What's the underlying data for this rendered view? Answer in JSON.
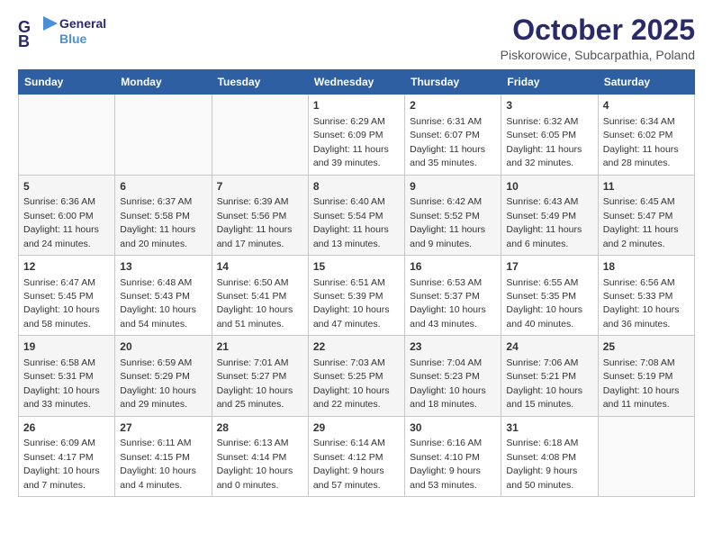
{
  "logo": {
    "line1": "General",
    "line2": "Blue"
  },
  "title": "October 2025",
  "subtitle": "Piskorowice, Subcarpathia, Poland",
  "headers": [
    "Sunday",
    "Monday",
    "Tuesday",
    "Wednesday",
    "Thursday",
    "Friday",
    "Saturday"
  ],
  "weeks": [
    [
      {
        "day": "",
        "info": ""
      },
      {
        "day": "",
        "info": ""
      },
      {
        "day": "",
        "info": ""
      },
      {
        "day": "1",
        "info": "Sunrise: 6:29 AM\nSunset: 6:09 PM\nDaylight: 11 hours\nand 39 minutes."
      },
      {
        "day": "2",
        "info": "Sunrise: 6:31 AM\nSunset: 6:07 PM\nDaylight: 11 hours\nand 35 minutes."
      },
      {
        "day": "3",
        "info": "Sunrise: 6:32 AM\nSunset: 6:05 PM\nDaylight: 11 hours\nand 32 minutes."
      },
      {
        "day": "4",
        "info": "Sunrise: 6:34 AM\nSunset: 6:02 PM\nDaylight: 11 hours\nand 28 minutes."
      }
    ],
    [
      {
        "day": "5",
        "info": "Sunrise: 6:36 AM\nSunset: 6:00 PM\nDaylight: 11 hours\nand 24 minutes."
      },
      {
        "day": "6",
        "info": "Sunrise: 6:37 AM\nSunset: 5:58 PM\nDaylight: 11 hours\nand 20 minutes."
      },
      {
        "day": "7",
        "info": "Sunrise: 6:39 AM\nSunset: 5:56 PM\nDaylight: 11 hours\nand 17 minutes."
      },
      {
        "day": "8",
        "info": "Sunrise: 6:40 AM\nSunset: 5:54 PM\nDaylight: 11 hours\nand 13 minutes."
      },
      {
        "day": "9",
        "info": "Sunrise: 6:42 AM\nSunset: 5:52 PM\nDaylight: 11 hours\nand 9 minutes."
      },
      {
        "day": "10",
        "info": "Sunrise: 6:43 AM\nSunset: 5:49 PM\nDaylight: 11 hours\nand 6 minutes."
      },
      {
        "day": "11",
        "info": "Sunrise: 6:45 AM\nSunset: 5:47 PM\nDaylight: 11 hours\nand 2 minutes."
      }
    ],
    [
      {
        "day": "12",
        "info": "Sunrise: 6:47 AM\nSunset: 5:45 PM\nDaylight: 10 hours\nand 58 minutes."
      },
      {
        "day": "13",
        "info": "Sunrise: 6:48 AM\nSunset: 5:43 PM\nDaylight: 10 hours\nand 54 minutes."
      },
      {
        "day": "14",
        "info": "Sunrise: 6:50 AM\nSunset: 5:41 PM\nDaylight: 10 hours\nand 51 minutes."
      },
      {
        "day": "15",
        "info": "Sunrise: 6:51 AM\nSunset: 5:39 PM\nDaylight: 10 hours\nand 47 minutes."
      },
      {
        "day": "16",
        "info": "Sunrise: 6:53 AM\nSunset: 5:37 PM\nDaylight: 10 hours\nand 43 minutes."
      },
      {
        "day": "17",
        "info": "Sunrise: 6:55 AM\nSunset: 5:35 PM\nDaylight: 10 hours\nand 40 minutes."
      },
      {
        "day": "18",
        "info": "Sunrise: 6:56 AM\nSunset: 5:33 PM\nDaylight: 10 hours\nand 36 minutes."
      }
    ],
    [
      {
        "day": "19",
        "info": "Sunrise: 6:58 AM\nSunset: 5:31 PM\nDaylight: 10 hours\nand 33 minutes."
      },
      {
        "day": "20",
        "info": "Sunrise: 6:59 AM\nSunset: 5:29 PM\nDaylight: 10 hours\nand 29 minutes."
      },
      {
        "day": "21",
        "info": "Sunrise: 7:01 AM\nSunset: 5:27 PM\nDaylight: 10 hours\nand 25 minutes."
      },
      {
        "day": "22",
        "info": "Sunrise: 7:03 AM\nSunset: 5:25 PM\nDaylight: 10 hours\nand 22 minutes."
      },
      {
        "day": "23",
        "info": "Sunrise: 7:04 AM\nSunset: 5:23 PM\nDaylight: 10 hours\nand 18 minutes."
      },
      {
        "day": "24",
        "info": "Sunrise: 7:06 AM\nSunset: 5:21 PM\nDaylight: 10 hours\nand 15 minutes."
      },
      {
        "day": "25",
        "info": "Sunrise: 7:08 AM\nSunset: 5:19 PM\nDaylight: 10 hours\nand 11 minutes."
      }
    ],
    [
      {
        "day": "26",
        "info": "Sunrise: 6:09 AM\nSunset: 4:17 PM\nDaylight: 10 hours\nand 7 minutes."
      },
      {
        "day": "27",
        "info": "Sunrise: 6:11 AM\nSunset: 4:15 PM\nDaylight: 10 hours\nand 4 minutes."
      },
      {
        "day": "28",
        "info": "Sunrise: 6:13 AM\nSunset: 4:14 PM\nDaylight: 10 hours\nand 0 minutes."
      },
      {
        "day": "29",
        "info": "Sunrise: 6:14 AM\nSunset: 4:12 PM\nDaylight: 9 hours\nand 57 minutes."
      },
      {
        "day": "30",
        "info": "Sunrise: 6:16 AM\nSunset: 4:10 PM\nDaylight: 9 hours\nand 53 minutes."
      },
      {
        "day": "31",
        "info": "Sunrise: 6:18 AM\nSunset: 4:08 PM\nDaylight: 9 hours\nand 50 minutes."
      },
      {
        "day": "",
        "info": ""
      }
    ]
  ]
}
